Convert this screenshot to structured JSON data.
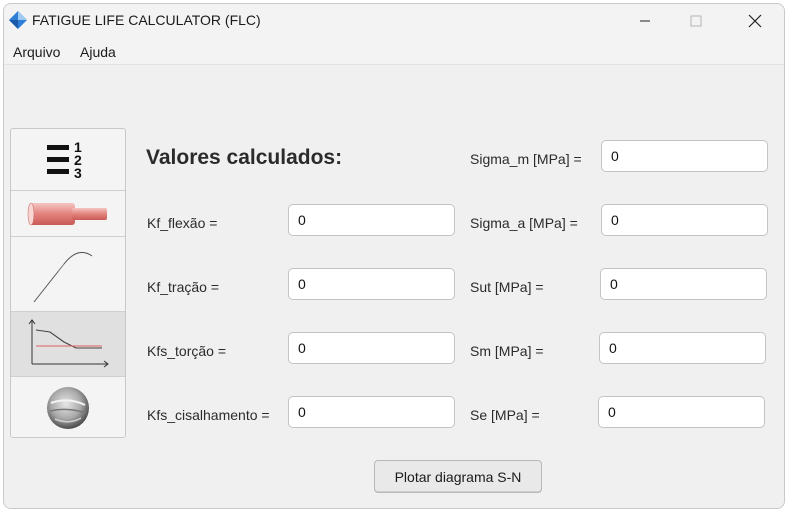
{
  "window": {
    "title": "FATIGUE LIFE CALCULATOR (FLC)"
  },
  "menu": {
    "file": "Arquivo",
    "help": "Ajuda"
  },
  "sidebar": {
    "buttons": [
      {
        "icon": "numbered-list-icon"
      },
      {
        "icon": "shaft-icon"
      },
      {
        "icon": "stress-strain-curve-icon"
      },
      {
        "icon": "sn-diagram-icon"
      },
      {
        "icon": "fracture-surface-icon"
      }
    ]
  },
  "main": {
    "heading": "Valores calculados:",
    "left_fields": [
      {
        "label": "Kf_flexão =",
        "value": "0"
      },
      {
        "label": "Kf_tração =",
        "value": "0"
      },
      {
        "label": "Kfs_torção =",
        "value": "0"
      },
      {
        "label": "Kfs_cisalhamento =",
        "value": "0"
      }
    ],
    "right_fields": [
      {
        "label": "Sigma_m [MPa] =",
        "value": "0"
      },
      {
        "label": "Sigma_a [MPa] =",
        "value": "0"
      },
      {
        "label": "Sut [MPa] =",
        "value": "0"
      },
      {
        "label": "Sm [MPa] =",
        "value": "0"
      },
      {
        "label": "Se [MPa] =",
        "value": "0"
      }
    ],
    "plot_button": "Plotar diagrama S-N"
  }
}
